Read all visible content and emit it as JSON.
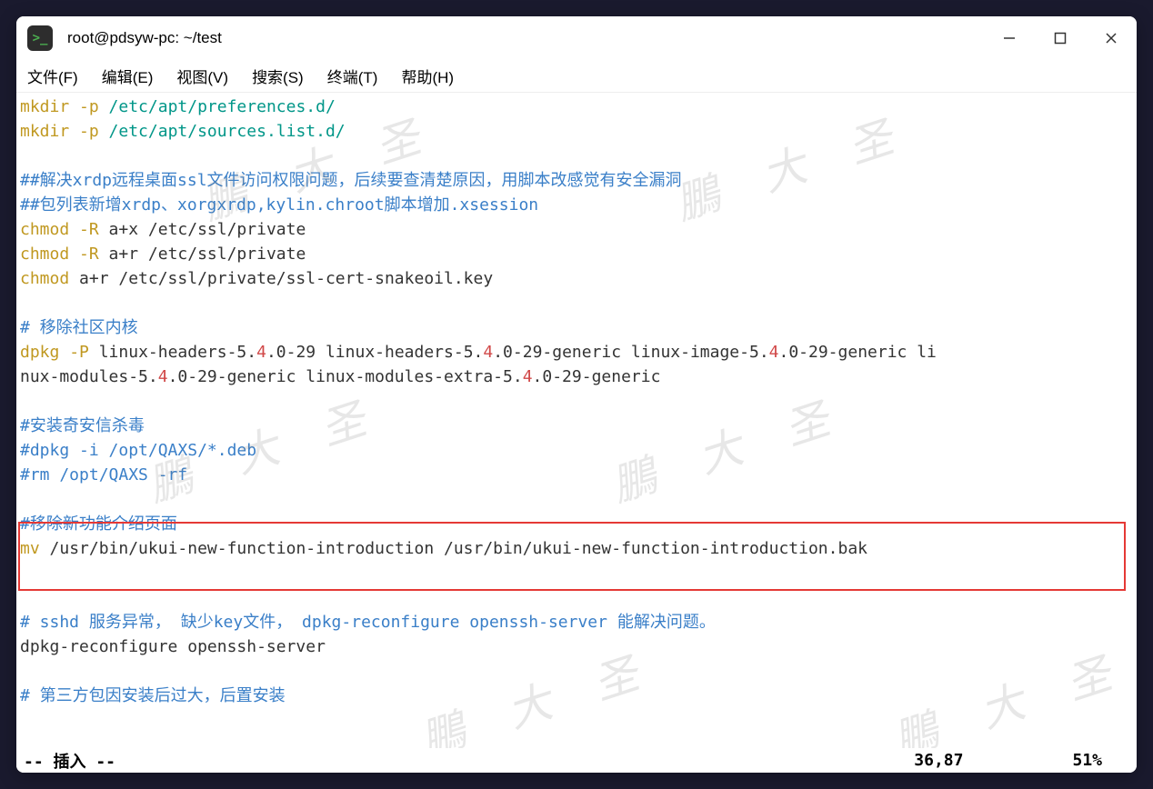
{
  "window": {
    "title": "root@pdsyw-pc: ~/test"
  },
  "menu": {
    "file": "文件(F)",
    "edit": "编辑(E)",
    "view": "视图(V)",
    "search": "搜索(S)",
    "terminal": "终端(T)",
    "help": "帮助(H)"
  },
  "lines": {
    "l1_cmd": "mkdir",
    "l1_opt": " -p ",
    "l1_arg": "/etc/apt/preferences.d/",
    "l2_cmd": "mkdir",
    "l2_opt": " -p ",
    "l2_arg": "/etc/apt/sources.list.d/",
    "l4": "##解决xrdp远程桌面ssl文件访问权限问题，后续要查清楚原因，用脚本改感觉有安全漏洞",
    "l5": "##包列表新增xrdp、xorgxrdp,kylin.chroot脚本增加.xsession",
    "l6_cmd": "chmod",
    "l6_opt": " -R ",
    "l6_arg": "a+x /etc/ssl/private",
    "l7_cmd": "chmod",
    "l7_opt": " -R ",
    "l7_arg": "a+r /etc/ssl/private",
    "l8_cmd": "chmod",
    "l8_arg": " a+r /etc/ssl/private/ssl-cert-snakeoil.key",
    "l10": "# 移除社区内核",
    "l11_cmd": "dpkg",
    "l11_opt": " -P ",
    "l11_p1": "linux-headers-5.",
    "l11_n1": "4",
    "l11_p2": ".0-29 linux-headers-5.",
    "l11_n2": "4",
    "l11_p3": ".0-29-generic linux-image-5.",
    "l11_n3": "4",
    "l11_p4": ".0-29-generic li",
    "l12_p1": "nux-modules-5.",
    "l12_n1": "4",
    "l12_p2": ".0-29-generic linux-modules-extra-5.",
    "l12_n2": "4",
    "l12_p3": ".0-29-generic",
    "l14": "#安装奇安信杀毒",
    "l15": "#dpkg -i /opt/QAXS/*.deb",
    "l16": "#rm /opt/QAXS -rf",
    "l18": "#移除新功能介绍页面",
    "l19_cmd": "mv",
    "l19_arg": " /usr/bin/ukui-new-function-introduction /usr/bin/ukui-new-function-introduction.bak",
    "l22": "# sshd 服务异常， 缺少key文件， dpkg-reconfigure openssh-server 能解决问题。",
    "l23": "dpkg-reconfigure openssh-server",
    "l25": "# 第三方包因安装后过大，后置安装"
  },
  "status": {
    "mode": "-- 插入 --",
    "position": "36,87",
    "percent": "51%"
  },
  "watermark": "鵬 大 圣"
}
